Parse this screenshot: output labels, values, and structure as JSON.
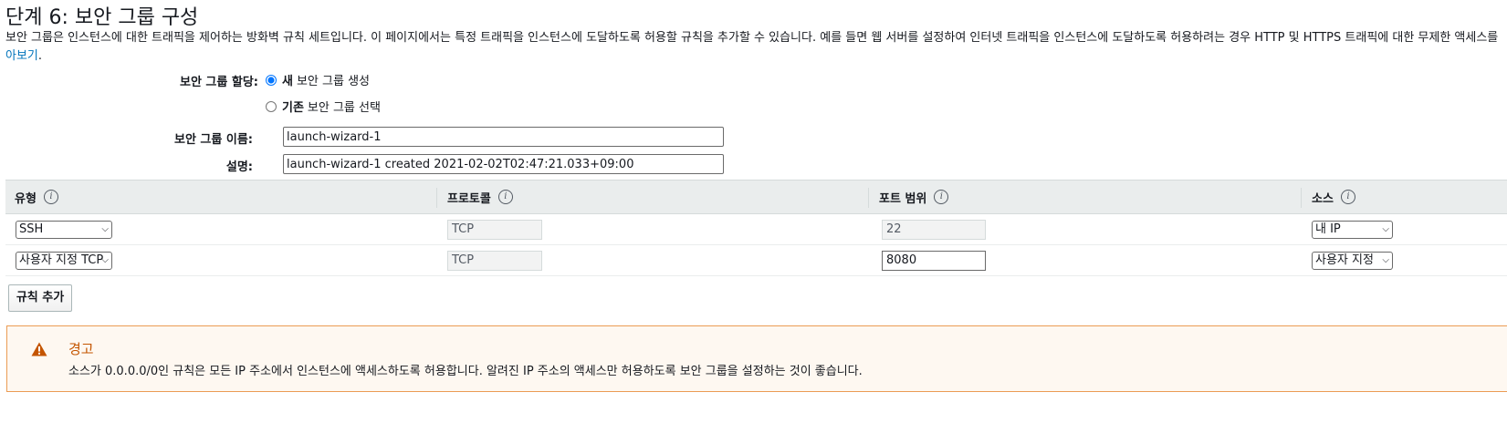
{
  "page": {
    "title": "단계 6: 보안 그룹 구성",
    "intro": "보안 그룹은 인스턴스에 대한 트래픽을 제어하는 방화벽 규칙 세트입니다. 이 페이지에서는 특정 트래픽을 인스턴스에 도달하도록 허용할 규칙을 추가할 수 있습니다. 예를 들면 웹 서버를 설정하여 인터넷 트래픽을 인스턴스에 도달하도록 허용하려는 경우 HTTP 및 HTTPS 트래픽에 대한 무제한 액세스를",
    "intro_link": "아보기",
    "intro_link_suffix": "."
  },
  "assign": {
    "label": "보안 그룹 할당:",
    "options": [
      {
        "bold": "새",
        "rest": "보안 그룹 생성",
        "checked": true
      },
      {
        "bold": "기존",
        "rest": "보안 그룹 선택",
        "checked": false
      }
    ]
  },
  "group_name": {
    "label": "보안 그룹 이름:",
    "value": "launch-wizard-1"
  },
  "description": {
    "label": "설명:",
    "value": "launch-wizard-1 created 2021-02-02T02:47:21.033+09:00"
  },
  "rules": {
    "columns": [
      "유형",
      "프로토콜",
      "포트 범위",
      "소스"
    ],
    "info_glyph": "i",
    "rows": [
      {
        "type": "SSH",
        "protocol": "TCP",
        "port": "22",
        "source": "내 IP"
      },
      {
        "type": "사용자 지정 TCP",
        "protocol": "TCP",
        "port": "8080",
        "source": "사용자 지정"
      }
    ]
  },
  "add_rule_label": "규칙 추가",
  "warning": {
    "title": "경고",
    "message": "소스가 0.0.0.0/0인 규칙은 모든 IP 주소에서 인스턴스에 액세스하도록 허용합니다. 알려진 IP 주소의 액세스만 허용하도록 보안 그룹을 설정하는 것이 좋습니다.",
    "icon": "warning-triangle-icon"
  },
  "colors": {
    "link": "#0073bb",
    "warning_accent": "#c45500",
    "warning_border": "#eb9c54"
  }
}
